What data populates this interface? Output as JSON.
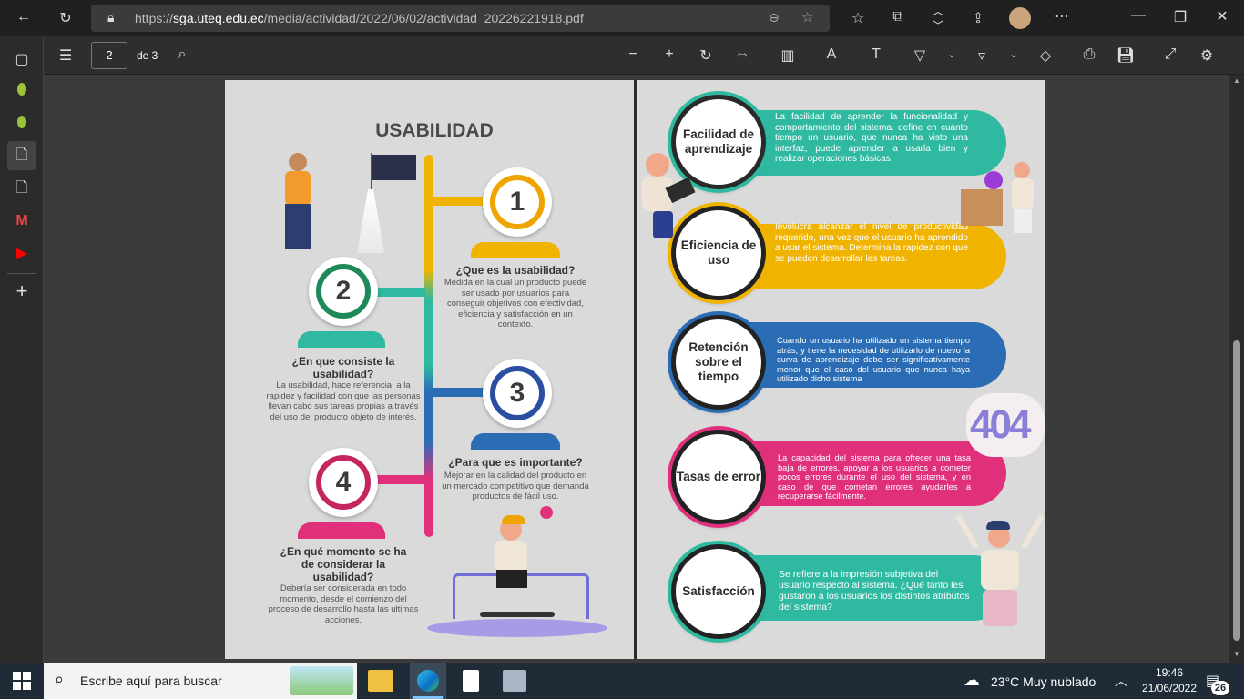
{
  "browser": {
    "url_prefix": "https://",
    "url_domain": "sga.uteq.edu.ec",
    "url_path": "/media/actividad/2022/06/02/actividad_20226221918.pdf"
  },
  "pdf_toolbar": {
    "page_number": "2",
    "page_total": "de 3"
  },
  "left_page": {
    "title": "USABILIDAD",
    "items": [
      {
        "num": "1",
        "heading": "¿Que es la usabilidad?",
        "body": "Medida en la cual un producto puede ser usado por usuarios para conseguir objetivos con efectividad, eficiencia y satisfacción en un contexto.",
        "color": "#f0a400"
      },
      {
        "num": "2",
        "heading": "¿En que consiste la usabilidad?",
        "body": "La usabilidad, hace referencia, a la rapidez y facilidad con que las personas llevan cabo sus tareas propias a través del uso del producto objeto de interés.",
        "color": "#2fb9a0"
      },
      {
        "num": "3",
        "heading": "¿Para que es importante?",
        "body": "Mejorar en la calidad del producto en un mercado competitivo que demanda productos de fácil uso.",
        "color": "#2a6db5"
      },
      {
        "num": "4",
        "heading": "¿En qué momento se ha de considerar la usabilidad?",
        "body": "Debería ser considerada en todo momento, desde el comienzo del proceso de desarrollo hasta las ultimas acciones.",
        "color": "#e0307c"
      }
    ]
  },
  "right_page": {
    "rows": [
      {
        "label": "Facilidad de aprendizaje",
        "text": "La facilidad de aprender la funcionalidad y comportamiento del sistema. define en cuánto tiempo un usuario, que nunca ha visto una interfaz, puede aprender a usarla bien y realizar operaciones básicas.",
        "color": "#2fb9a0"
      },
      {
        "label": "Eficiencia de uso",
        "text": "Involucra alcanzar el nivel de productividad requerido, una vez que el usuario ha aprendido a usar el sistema. Determina la rapidez con que se pueden desarrollar las tareas.",
        "color": "#f0b400"
      },
      {
        "label": "Retención sobre el tiempo",
        "text": "Cuando un usuario ha utilizado un sistema tiempo atrás, y tiene la necesidad de utilizarlo de nuevo la curva de aprendizaje debe ser significativamente menor que el caso del usuario que nunca haya utilizado dicho sistema",
        "color": "#2a6db5"
      },
      {
        "label": "Tasas de error",
        "text": "La capacidad del sistema para ofrecer una tasa baja de errores, apoyar a los usuarios a cometer pocos errores durante el uso del sistema, y en caso de que cometan errores ayudarles a recuperarse fácilmente.",
        "color": "#e0307c"
      },
      {
        "label": "Satisfacción",
        "text": "Se refiere a la impresión subjetiva del usuario respecto al sistema. ¿Qué tanto les gustaron a los usuarios los distintos atributos del sistema?",
        "color": "#2fb9a0"
      }
    ],
    "deco_404": "404"
  },
  "taskbar": {
    "search_placeholder": "Escribe aquí para buscar",
    "weather": "23°C  Muy nublado",
    "time": "19:46",
    "date": "21/06/2022",
    "notifications": "26"
  }
}
